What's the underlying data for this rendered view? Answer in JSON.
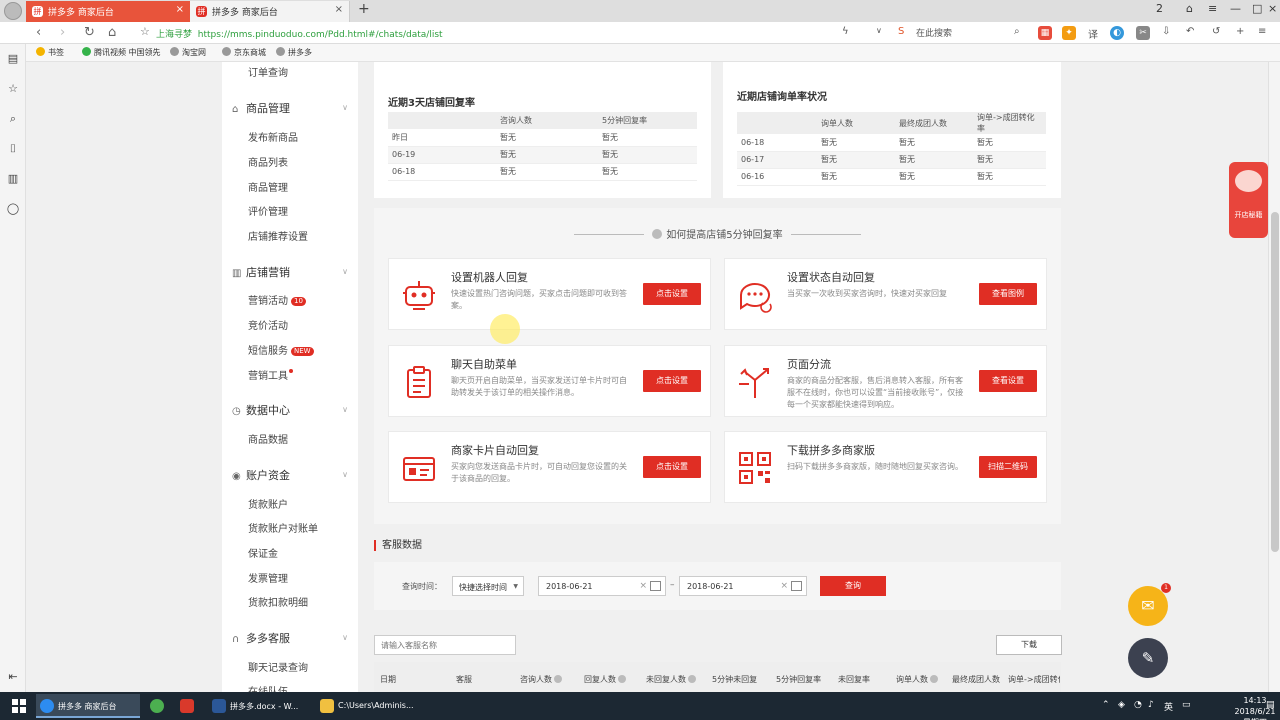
{
  "browser": {
    "tabs": [
      {
        "label": "拼多多 商家后台",
        "active": true
      },
      {
        "label": "拼多多 商家后台",
        "active": false
      }
    ],
    "tab_counter": "2",
    "url_label": "上海寻梦",
    "url": "https://mms.pinduoduo.com/Pdd.html#/chats/data/list",
    "search_engine_label": "在此搜索",
    "translate_label": "译",
    "bookmarks": [
      "书签",
      "腾讯视频 中国领先",
      "淘宝网",
      "京东商城",
      "拼多多"
    ]
  },
  "sidebar": {
    "top_partial": "订单查询",
    "groups": [
      {
        "title": "商品管理",
        "items": [
          "发布新商品",
          "商品列表",
          "商品管理",
          "评价管理",
          "店铺推荐设置"
        ]
      },
      {
        "title": "店铺营销",
        "items": [
          "营销活动",
          "竞价活动",
          "短信服务",
          "营销工具"
        ],
        "badges": {
          "营销活动": "10",
          "短信服务": "NEW"
        }
      },
      {
        "title": "数据中心",
        "items": [
          "商品数据"
        ]
      },
      {
        "title": "账户资金",
        "items": [
          "货款账户",
          "货款账户对账单",
          "保证金",
          "发票管理",
          "货款扣款明细"
        ]
      },
      {
        "title": "多多客服",
        "items": [
          "聊天记录查询",
          "在线队伍"
        ]
      }
    ]
  },
  "reply_rate_table": {
    "title": "近期3天店铺回复率",
    "headers": [
      "",
      "咨询人数",
      "5分钟回复率"
    ],
    "rows": [
      [
        "昨日",
        "暂无",
        "暂无"
      ],
      [
        "06-19",
        "暂无",
        "暂无"
      ],
      [
        "06-18",
        "暂无",
        "暂无"
      ]
    ]
  },
  "conversion_table": {
    "title": "近期店铺询单率状况",
    "headers": [
      "",
      "询单人数",
      "最终成团人数",
      "询单->成团转化率"
    ],
    "rows": [
      [
        "06-18",
        "暂无",
        "暂无",
        "暂无"
      ],
      [
        "06-17",
        "暂无",
        "暂无",
        "暂无"
      ],
      [
        "06-16",
        "暂无",
        "暂无",
        "暂无"
      ]
    ]
  },
  "tips": {
    "title": "如何提高店铺5分钟回复率",
    "cards": [
      {
        "title": "设置机器人回复",
        "desc": "快速设置热门咨询问题，买家点击问题即可收到答案。",
        "button": "点击设置",
        "icon": "robot-icon"
      },
      {
        "title": "设置状态自动回复",
        "desc": "当买家一次收到买家咨询时，快速对买家回复",
        "button": "查看图例",
        "icon": "chat-bubble-icon"
      },
      {
        "title": "聊天自助菜单",
        "desc": "聊天页开启自助菜单，当买家发送订单卡片时可自助转发关于该订单的相关操作消息。",
        "button": "点击设置",
        "icon": "clipboard-icon"
      },
      {
        "title": "页面分流",
        "desc": "商家的商品分配客服，售后消息转入客服，所有客服不在线时，你也可以设置“当前接收账号”，仅接每一个买家都能快速得到响应。",
        "button": "查看设置",
        "icon": "fork-arrows-icon"
      },
      {
        "title": "商家卡片自动回复",
        "desc": "买家向您发送商品卡片时，可自动回复您设置的关于该商品的回复。",
        "button": "点击设置",
        "icon": "id-card-icon"
      },
      {
        "title": "下载拼多多商家版",
        "desc": "扫码下载拼多多商家版，随时随地回复买家咨询。",
        "button": "扫描二维码",
        "icon": "qr-code-icon"
      }
    ]
  },
  "service_data": {
    "title": "客服数据",
    "filter_label": "查询时间：",
    "select_value": "快捷选择时间",
    "start_date": "2018-06-21",
    "end_date": "2018-06-21",
    "query_button": "查询",
    "search_placeholder": "请输入客服名称",
    "download_button": "下载",
    "columns": [
      "日期",
      "客服",
      "咨询人数",
      "回复人数",
      "未回复人数",
      "5分钟未回复",
      "5分钟回复率",
      "未回复率",
      "询单人数",
      "最终成团人数",
      "询单->成团转化率"
    ]
  },
  "floating": {
    "promo_label": "开店秘籍",
    "mail_badge": "1"
  },
  "taskbar": {
    "tasks": [
      "拼多多 商家后台",
      "拼多多.docx - W...",
      "C:\\Users\\Adminis..."
    ],
    "time": "14:13",
    "date": "2018/6/21 星期四",
    "ime": "英"
  }
}
